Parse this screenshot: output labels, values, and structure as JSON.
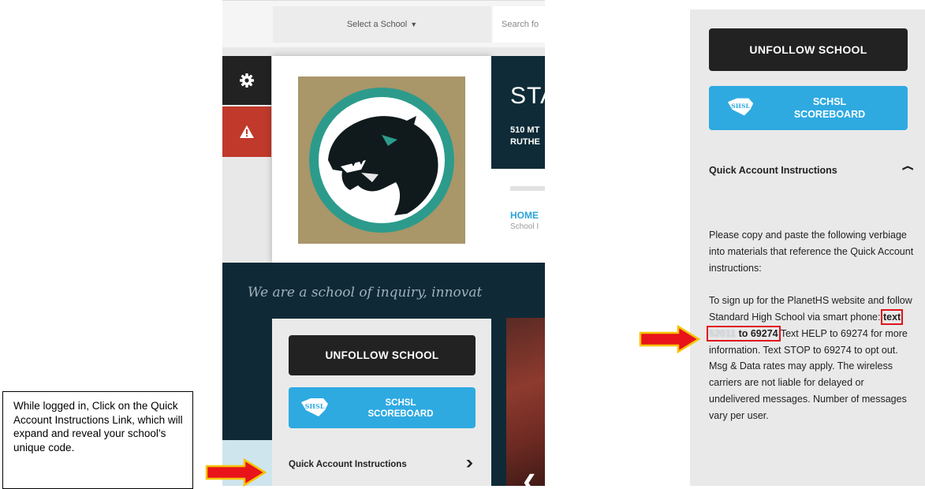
{
  "header": {
    "select_school": "Select a School",
    "search_placeholder": "Search fo"
  },
  "school": {
    "name": "STA",
    "address_line1": "510 MT",
    "address_line2": "RUTHE"
  },
  "nav": {
    "home": "HOME",
    "sub": "School I"
  },
  "motto": "We are a school of inquiry, innovat",
  "buttons": {
    "unfollow": "UNFOLLOW SCHOOL",
    "scoreboard_line1": "SCHSL",
    "scoreboard_line2": "SCOREBOARD"
  },
  "quick_account": {
    "header": "Quick Account Instructions",
    "intro": "Please copy and paste the following verbiage into materials that reference the Quick Account instructions:",
    "body_before": "To sign up for the PlanetHS website and follow Standard High School via smart phone:",
    "code_prefix": "text",
    "code_redacted": "52011",
    "code_suffix": "to 69274",
    "body_after": "Text HELP to 69274 for more information. Text STOP to 69274 to opt out. Msg & Data rates may apply. The wireless carriers are not liable for delayed or undelivered messages. Number of messages vary per user."
  },
  "callout": "While logged in, Click on the Quick Account Instructions Link, which will expand and reveal your school’s unique code.",
  "colors": {
    "accent_blue": "#2eaae1",
    "dark": "#222222",
    "alert_red": "#c0392b",
    "navy": "#0e2b37",
    "arrow_red": "#e8141a",
    "arrow_yellow": "#f5c400"
  },
  "icons": [
    "gear-icon",
    "alert-icon",
    "caret-down-icon",
    "panther-logo",
    "schsl-logo",
    "chevron-down-icon",
    "chevron-up-icon",
    "chevron-left-icon",
    "pointer-arrow"
  ]
}
